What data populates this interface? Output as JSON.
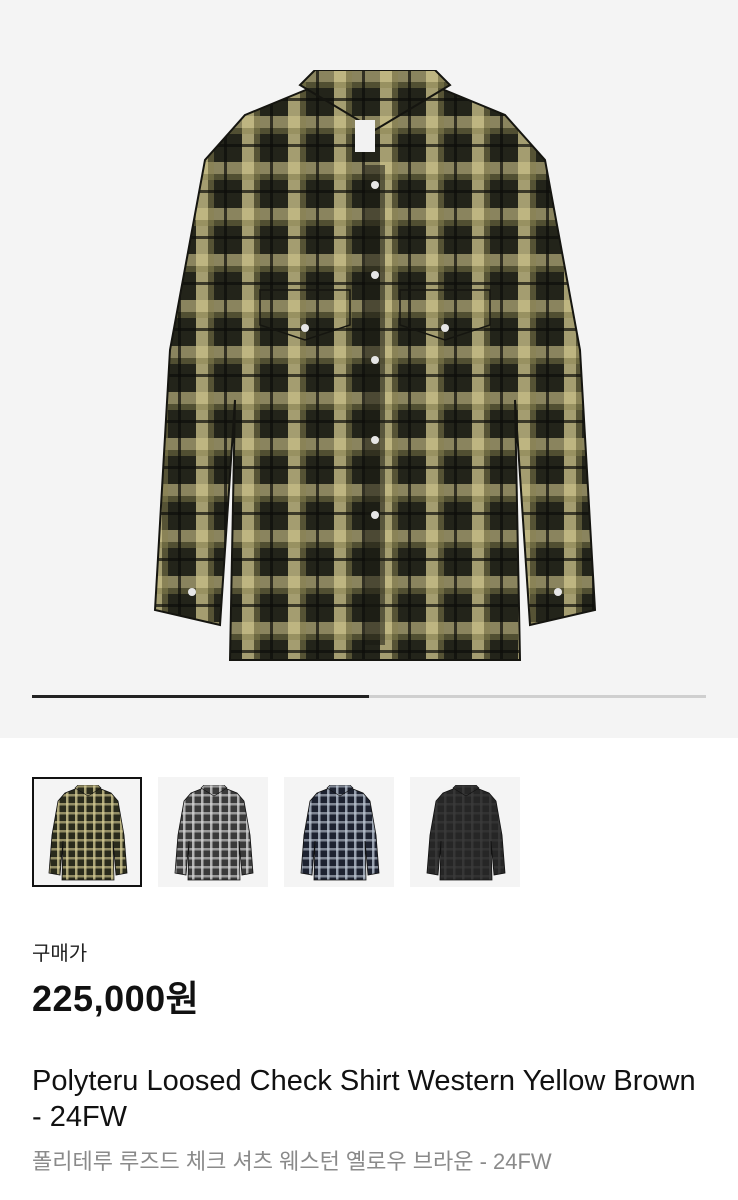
{
  "gallery": {
    "progress": 0.5,
    "thumbnails": [
      {
        "color_name": "yellow-brown",
        "fabric": "#2a2b1c",
        "check": "#d8cf96",
        "active": true
      },
      {
        "color_name": "grey",
        "fabric": "#3a3a3a",
        "check": "#d9d9d9",
        "active": false
      },
      {
        "color_name": "navy",
        "fabric": "#1d2230",
        "check": "#bfc8d6",
        "active": false
      },
      {
        "color_name": "black",
        "fabric": "#262626",
        "check": "#3a3a3a",
        "active": false
      }
    ]
  },
  "product": {
    "price_label": "구매가",
    "price": "225,000원",
    "title": "Polyteru Loosed Check Shirt Western Yellow Brown - 24FW",
    "subtitle": "폴리테루 루즈드 체크 셔츠 웨스턴 옐로우 브라운 - 24FW"
  }
}
